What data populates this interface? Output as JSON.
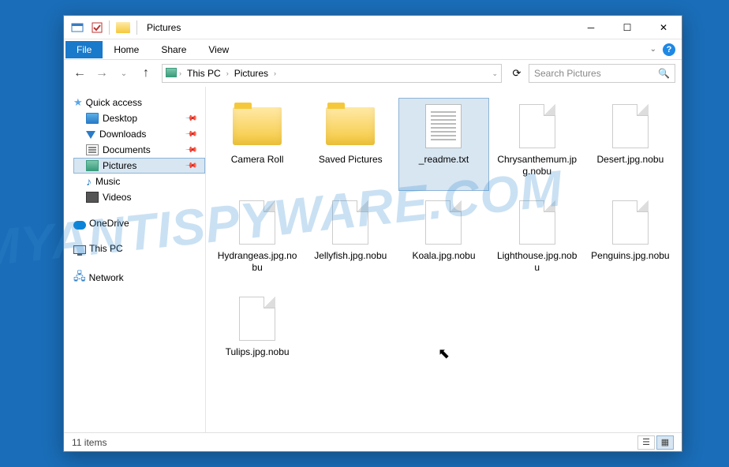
{
  "titlebar": {
    "title": "Pictures"
  },
  "ribbon": {
    "file": "File",
    "home": "Home",
    "share": "Share",
    "view": "View"
  },
  "address": {
    "seg0": "",
    "seg1": "This PC",
    "seg2": "Pictures"
  },
  "search": {
    "placeholder": "Search Pictures"
  },
  "sidebar": {
    "quick_access": "Quick access",
    "desktop": "Desktop",
    "downloads": "Downloads",
    "documents": "Documents",
    "pictures": "Pictures",
    "music": "Music",
    "videos": "Videos",
    "onedrive": "OneDrive",
    "thispc": "This PC",
    "network": "Network"
  },
  "items": {
    "camera_roll": "Camera Roll",
    "saved_pictures": "Saved Pictures",
    "readme": "_readme.txt",
    "chrys": "Chrysanthemum.jpg.nobu",
    "desert": "Desert.jpg.nobu",
    "hydrangeas": "Hydrangeas.jpg.nobu",
    "jellyfish": "Jellyfish.jpg.nobu",
    "koala": "Koala.jpg.nobu",
    "lighthouse": "Lighthouse.jpg.nobu",
    "penguins": "Penguins.jpg.nobu",
    "tulips": "Tulips.jpg.nobu"
  },
  "status": {
    "count": "11 items"
  },
  "watermark": "MYANTISPYWARE.COM"
}
